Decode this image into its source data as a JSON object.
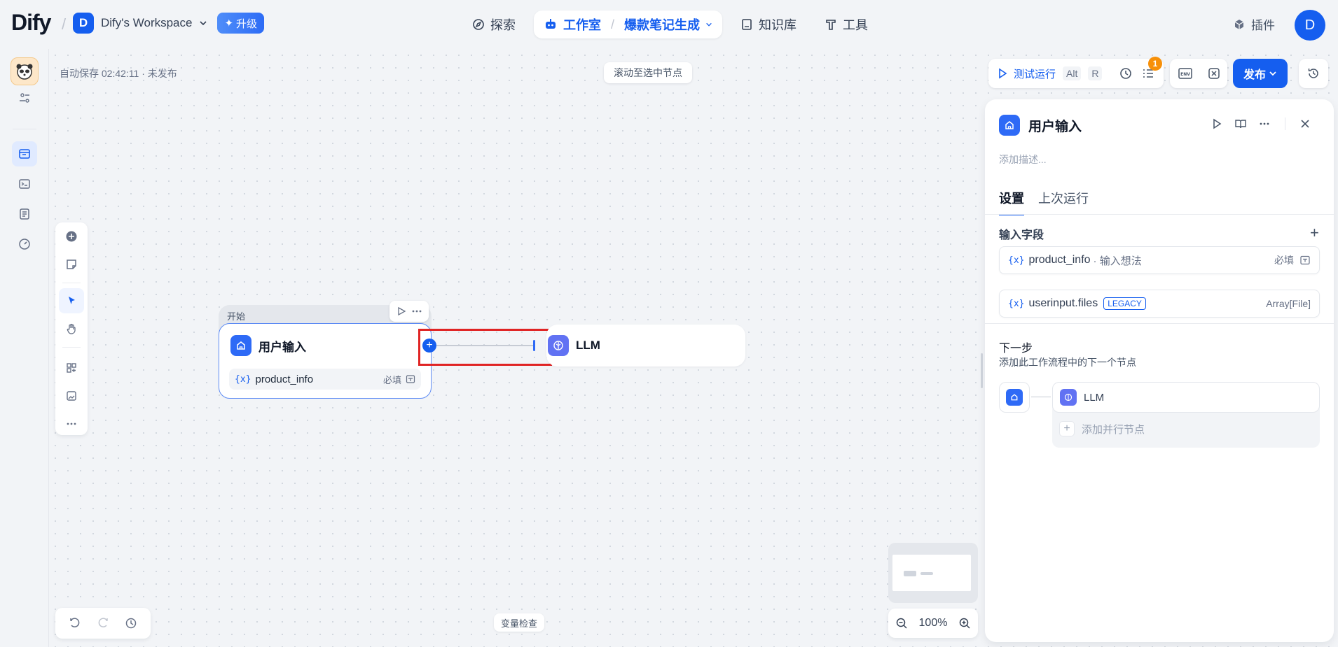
{
  "header": {
    "logo_text": "Dify",
    "workspace_initial": "D",
    "workspace_name": "Dify's Workspace",
    "upgrade_label": "升级",
    "nav": {
      "explore": "探索",
      "studio": "工作室",
      "app_name": "爆款笔记生成",
      "knowledge": "知识库",
      "tools": "工具"
    },
    "plugins": "插件",
    "user_initial": "D"
  },
  "canvas": {
    "autosave": "自动保存 02:42:11 · 未发布",
    "scroll_to_node": "滚动至选中节点",
    "variable_inspect": "变量检查",
    "zoom_level": "100%"
  },
  "start_node": {
    "group_label": "开始",
    "title": "用户输入",
    "field_var_icon": "{x}",
    "field_name": "product_info",
    "field_required": "必填"
  },
  "llm_node": {
    "title": "LLM"
  },
  "toolbar": {
    "test_run": "测试运行",
    "shortcut_1": "Alt",
    "shortcut_2": "R",
    "badge_count": "1",
    "publish": "发布"
  },
  "panel": {
    "title": "用户输入",
    "description_placeholder": "添加描述...",
    "tabs": [
      "设置",
      "上次运行"
    ],
    "input_section_title": "输入字段",
    "fields": [
      {
        "var_icon": "{x}",
        "name": "product_info",
        "hint": "· 输入想法",
        "right": "必填"
      },
      {
        "var_icon": "{x}",
        "name": "userinput.files",
        "tag": "LEGACY",
        "right": "Array[File]"
      }
    ],
    "next_title": "下一步",
    "next_desc": "添加此工作流程中的下一个节点",
    "next_node": "LLM",
    "add_parallel": "添加并行节点"
  },
  "colors": {
    "primary": "#155eef",
    "llm": "#6172f3",
    "highlight": "#e02424",
    "badge": "#f79009"
  }
}
